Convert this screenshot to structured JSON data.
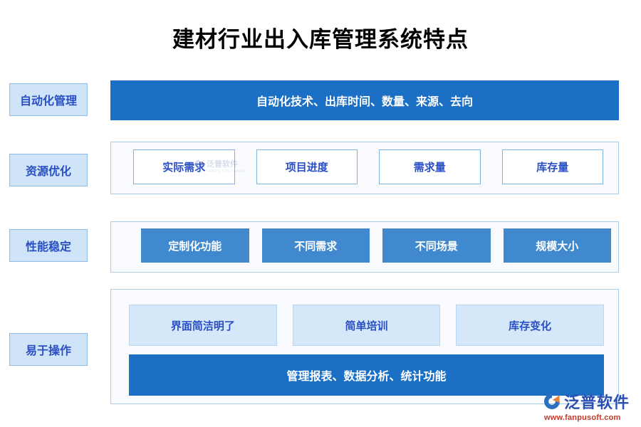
{
  "page": {
    "title": "建材行业出入库管理系统特点"
  },
  "categories": [
    {
      "label": "自动化管理"
    },
    {
      "label": "资源优化"
    },
    {
      "label": "性能稳定"
    },
    {
      "label": "易于操作"
    }
  ],
  "rows": {
    "row1": {
      "banner_text": "自动化技术、出库时间、数量、来源、去向"
    },
    "row2": {
      "items": [
        {
          "label": "实际需求"
        },
        {
          "label": "项目进度"
        },
        {
          "label": "需求量"
        },
        {
          "label": "库存量"
        }
      ]
    },
    "row3": {
      "items": [
        {
          "label": "定制化功能"
        },
        {
          "label": "不同需求"
        },
        {
          "label": "不同场景"
        },
        {
          "label": "规模大小"
        }
      ]
    },
    "row4": {
      "items": [
        {
          "label": "界面简洁明了"
        },
        {
          "label": "简单培训"
        },
        {
          "label": "库存变化"
        }
      ],
      "banner_text": "管理报表、数据分析、统计功能"
    }
  },
  "watermark": {
    "name": "泛普软件",
    "subtitle": "FANPU SOFTWARE"
  },
  "logo": {
    "name": "泛普软件",
    "url": "www.fanpusoft.com"
  },
  "colors": {
    "banner_blue": "#1b6fc4",
    "chip_blue": "#4189ce",
    "chip_light_blue": "#d4e8fa",
    "label_blue": "#cfe4f7",
    "text_blue": "#2a4fc4",
    "panel_bg": "#f9fbfe",
    "panel_border": "#a8cdeb",
    "logo_text": "#2a4fb0",
    "logo_url": "#c0392b"
  }
}
